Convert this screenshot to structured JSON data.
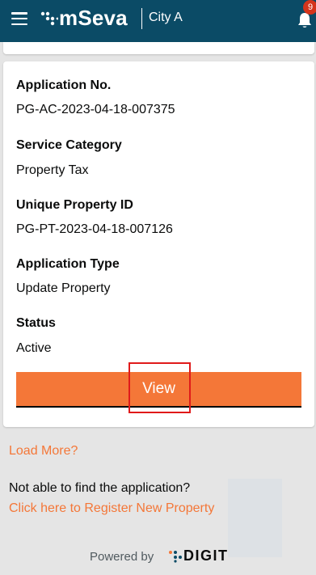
{
  "header": {
    "brand": "mSeva",
    "city": "City A",
    "notification_count": "9",
    "background": "#0b4b66"
  },
  "application": {
    "fields": [
      {
        "label": "Application No.",
        "value": "PG-AC-2023-04-18-007375"
      },
      {
        "label": "Service Category",
        "value": "Property Tax"
      },
      {
        "label": "Unique Property ID",
        "value": "PG-PT-2023-04-18-007126"
      },
      {
        "label": "Application Type",
        "value": "Update Property"
      },
      {
        "label": "Status",
        "value": "Active"
      }
    ],
    "view_label": "View",
    "accent": "#f47738"
  },
  "footer": {
    "load_more": "Load More?",
    "not_able": "Not able to find the application?",
    "register_link": "Click here to Register New Property",
    "powered_by": "Powered by",
    "digit": "DIGIT"
  },
  "icons": [
    "hamburger-icon",
    "mseva-logo-icon",
    "bell-icon",
    "digit-logo-icon"
  ]
}
